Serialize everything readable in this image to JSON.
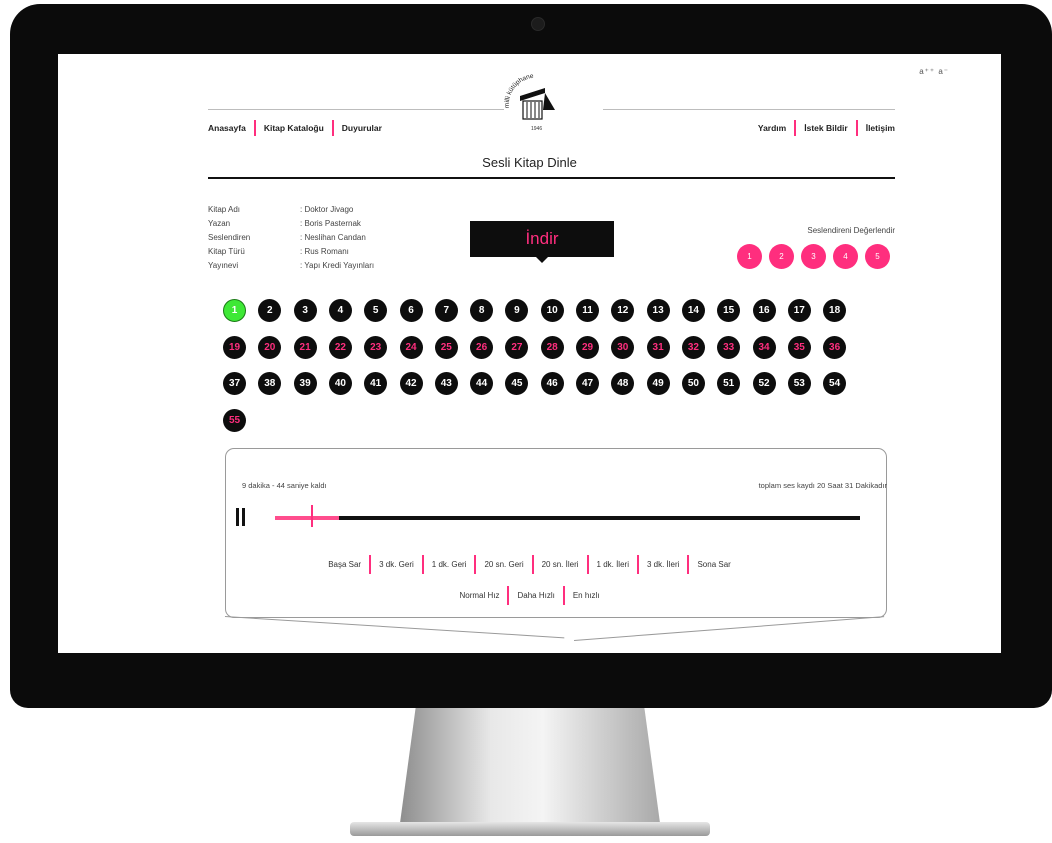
{
  "header": {
    "font_controls": "a⁺⁺  a⁻",
    "logo_arc_text": "milli kütüphane",
    "logo_year": "1946",
    "nav_left": [
      "Anasayfa",
      "Kitap Kataloğu",
      "Duyurular"
    ],
    "nav_right": [
      "Yardım",
      "İstek Bildir",
      "İletişim"
    ],
    "page_title": "Sesli Kitap Dinle"
  },
  "book_info": {
    "rows": [
      {
        "label": "Kitap Adı",
        "value": ": Doktor Jivago"
      },
      {
        "label": "Yazan",
        "value": ": Boris Pasternak"
      },
      {
        "label": "Seslendiren",
        "value": ": Neslihan Candan"
      },
      {
        "label": "Kitap Türü",
        "value": ": Rus Romanı"
      },
      {
        "label": "Yayınevi",
        "value": ": Yapı Kredi Yayınları"
      }
    ]
  },
  "download_label": "İndir",
  "rating": {
    "title": "Seslendireni Değerlendir",
    "options": [
      "1",
      "2",
      "3",
      "4",
      "5"
    ]
  },
  "chapters": {
    "labels": [
      "1",
      "2",
      "3",
      "4",
      "5",
      "6",
      "7",
      "8",
      "9",
      "10",
      "11",
      "12",
      "13",
      "14",
      "15",
      "16",
      "17",
      "18",
      "19",
      "20",
      "21",
      "22",
      "23",
      "24",
      "25",
      "26",
      "27",
      "28",
      "29",
      "30",
      "31",
      "32",
      "33",
      "34",
      "35",
      "36",
      "37",
      "38",
      "39",
      "40",
      "41",
      "42",
      "43",
      "44",
      "45",
      "46",
      "47",
      "48",
      "49",
      "50",
      "51",
      "52",
      "53",
      "54",
      "55"
    ],
    "active": "1",
    "pink_labels": [
      "19",
      "20",
      "21",
      "22",
      "23",
      "24",
      "25",
      "26",
      "27",
      "28",
      "29",
      "30",
      "31",
      "32",
      "33",
      "34",
      "35",
      "36",
      "55"
    ]
  },
  "player": {
    "remaining": "9 dakika - 44 saniye kaldı",
    "total": "toplam ses kaydı 20 Saat 31 Dakikadır",
    "progress_fraction": 0.11,
    "seek_buttons": [
      "Başa Sar",
      "3 dk. Geri",
      "1 dk. Geri",
      "20 sn. Geri",
      "20 sn. İleri",
      "1 dk. İleri",
      "3 dk. İleri",
      "Sona Sar"
    ],
    "speed_buttons": [
      "Normal Hız",
      "Daha Hızlı",
      "En hızlı"
    ]
  },
  "colors": {
    "accent": "#ff2e7e",
    "active_chapter": "#3ee836",
    "dark": "#0d0d0d"
  }
}
